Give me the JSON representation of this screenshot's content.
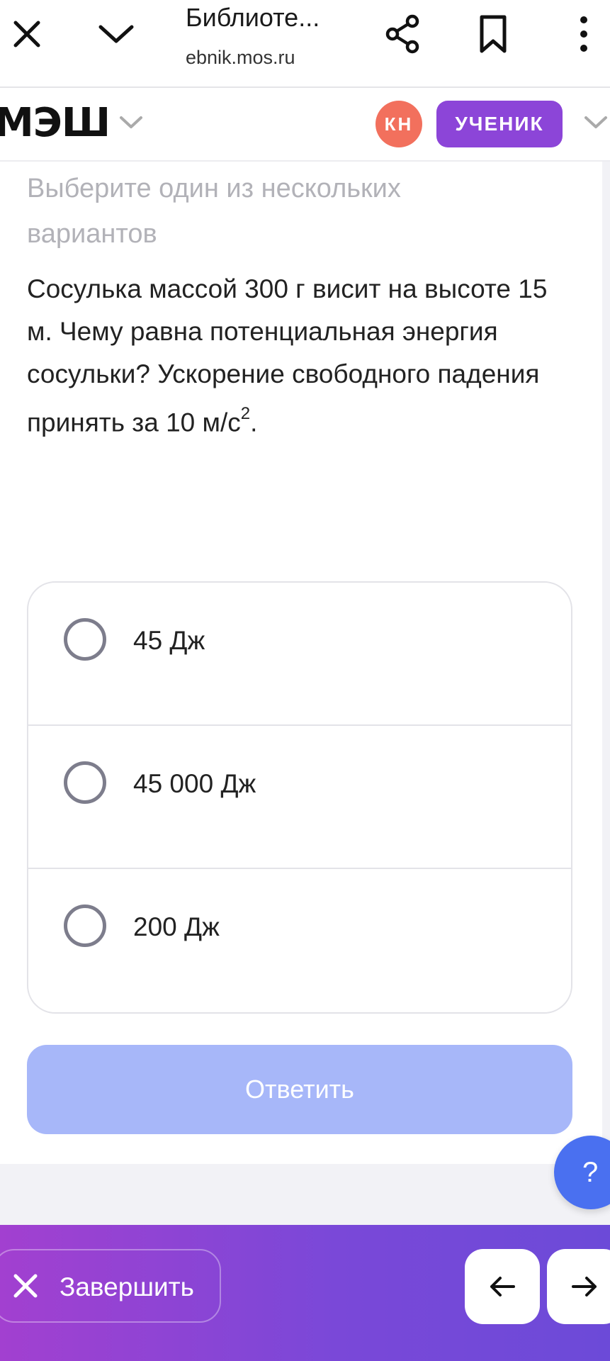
{
  "browser": {
    "title": "Библиоте...",
    "url": "ebnik.mos.ru"
  },
  "header": {
    "logo": "МЭШ",
    "avatar_initials": "КН",
    "role_label": "УЧЕНИК"
  },
  "task": {
    "instruction": "Выберите один из нескольких вариантов",
    "question_text": "Сосулька массой 300 г висит на высоте 15 м. Чему равна потенциальная энергия сосульки? Ускорение свободного падения принять за 10 м/с",
    "question_sup": "2",
    "question_end": ".",
    "options": [
      {
        "label": "45 Дж"
      },
      {
        "label": "45 000 Дж"
      },
      {
        "label": "200 Дж"
      }
    ],
    "answer_label": "Ответить"
  },
  "help": {
    "label": "?"
  },
  "bottom": {
    "finish_label": "Завершить"
  },
  "icons": {
    "close": "close-icon",
    "chevron": "chevron-down-icon",
    "share": "share-icon",
    "bookmark": "bookmark-icon",
    "more": "more-vertical-icon",
    "prev": "arrow-left-icon",
    "next": "arrow-right-icon"
  },
  "colors": {
    "accent_purple": "#8c45d8",
    "avatar_red": "#f2705d",
    "answer_button_disabled": "#a7b7f9",
    "help_blue": "#4a70f0"
  }
}
